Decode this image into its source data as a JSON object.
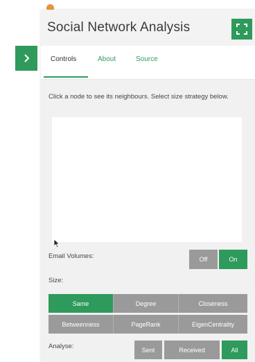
{
  "header": {
    "title": "Social Network Analysis"
  },
  "tabs": [
    {
      "label": "Controls"
    },
    {
      "label": "About"
    },
    {
      "label": "Source"
    }
  ],
  "controls": {
    "instructions": "Click a node to see its neighbours. Select size strategy below.",
    "email_volumes": {
      "label": "Email Volumes:",
      "options": [
        "Off",
        "On"
      ],
      "selected": "On"
    },
    "size": {
      "label": "Size:",
      "options_row1": [
        "Same",
        "Degree",
        "Closeness"
      ],
      "options_row2": [
        "Betweenness",
        "PageRank",
        "EigenCentrality"
      ],
      "selected": "Same"
    },
    "analyse": {
      "label": "Analyse:",
      "options": [
        "Sent",
        "Received",
        "All"
      ],
      "selected": "All"
    }
  },
  "colors": {
    "accent": "#2e9a5c",
    "inactive_button": "#9a9a9a",
    "indicator_dot": "#e8953a"
  }
}
